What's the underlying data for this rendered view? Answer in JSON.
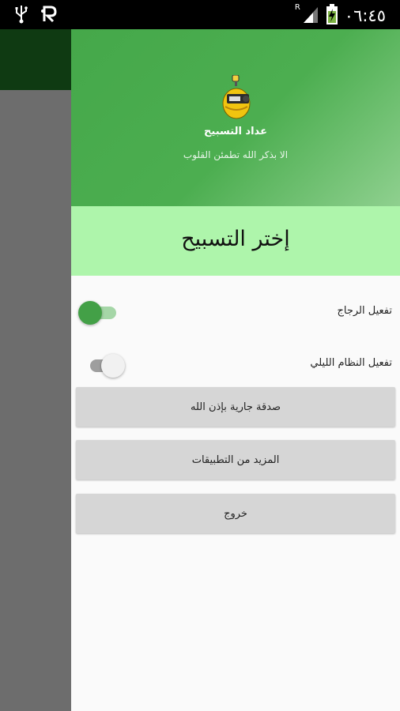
{
  "status_bar": {
    "icons_left": [
      "usb-icon",
      "r-notification-icon"
    ],
    "icons_right": [
      "roaming-r-icon",
      "signal-icon",
      "battery-charging-icon"
    ],
    "roaming": "R",
    "time": "٠٦:٤٥"
  },
  "drawer": {
    "header": {
      "app_name": "عداد التسبيح",
      "subtitle": "الا بذكر الله تطمئن القلوب",
      "icon": "tally-counter-icon"
    },
    "choose_label": "إختر التسبيح",
    "settings": [
      {
        "label": "تفعيل الرجاج",
        "state": "on"
      },
      {
        "label": "تفعيل النظام الليلي",
        "state": "off"
      }
    ],
    "buttons": [
      {
        "label": "صدقة جارية بإذن الله"
      },
      {
        "label": "المزيد من التطبيقات"
      },
      {
        "label": "خروج"
      }
    ]
  },
  "colors": {
    "header_green": "#4cae50",
    "choose_bar": "#aef5ab",
    "toggle_on": "#43a047"
  }
}
